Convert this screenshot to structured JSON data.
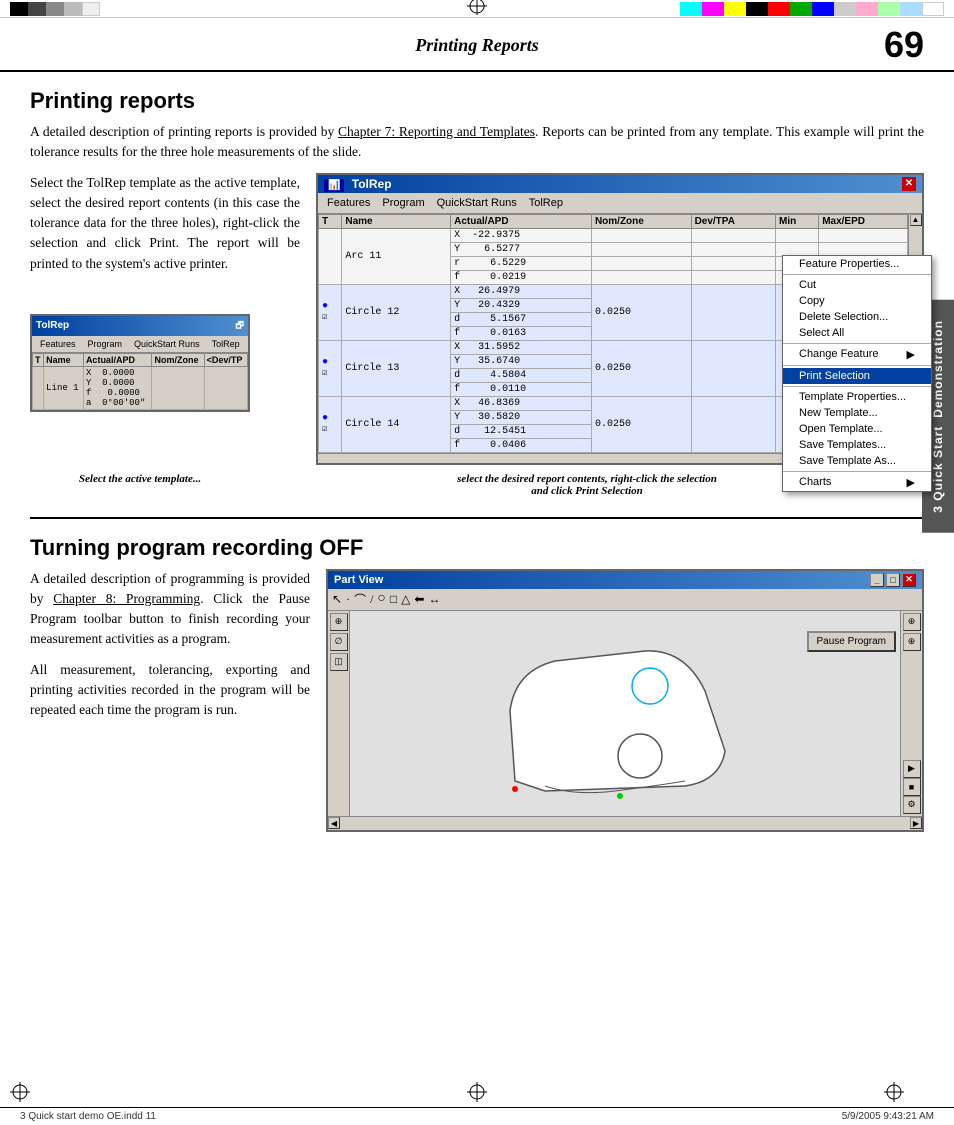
{
  "page": {
    "title": "Printing Reports",
    "page_number": "69"
  },
  "top_bar": {
    "color_squares": [
      "#000",
      "#444",
      "#888",
      "#bbb",
      "#eee"
    ],
    "color_bars_right": [
      "#00FFFF",
      "#FF00FF",
      "#FFFF00",
      "#000",
      "#ff0000",
      "#00aa00",
      "#0000ff",
      "#cccccc",
      "#ffaabb",
      "#aaffaa",
      "#aaddff",
      "#ffffff"
    ]
  },
  "section1": {
    "title": "Printing reports",
    "body1": "A detailed description of printing reports is provided by Chapter 7:  Reporting and Templates.  Reports can be printed from any template.  This example will print the tolerance results for the three hole measurements of the slide.",
    "body2": "Select the TolRep template as the active template, select the desired report contents (in this case the tolerance data for the three holes), right-click the selection and click Print.  The report will be printed to the system's active printer.",
    "link1": "Chapter 7:  Reporting and Templates"
  },
  "tolrep_window": {
    "title": "TolRep",
    "menu_items": [
      "Features",
      "Program",
      "QuickStart Runs",
      "TolRep"
    ],
    "table_headers": [
      "T",
      "Name",
      "Actual/APD",
      "Nom/Zone",
      "Dev/TPA",
      "Min",
      "Max/EPD"
    ],
    "rows": [
      {
        "name": "Arc 11",
        "axis": [
          "X",
          "Y",
          "r",
          "f"
        ],
        "values": [
          "-22.9375",
          "6.5277",
          "6.5229",
          "0.0219"
        ],
        "nom_zone": "",
        "dev_tpa": "",
        "min": "",
        "max_epd": "",
        "dot": false
      },
      {
        "name": "Circle 12",
        "axis": [
          "X",
          "Y",
          "d",
          "f"
        ],
        "values": [
          "26.4979",
          "20.4329",
          "5.1567",
          "0.0163"
        ],
        "nom_zone": "0.0250",
        "dev_tpa": "",
        "min": "",
        "max_epd": "",
        "dot": true
      },
      {
        "name": "Circle 13",
        "axis": [
          "X",
          "Y",
          "d",
          "f"
        ],
        "values": [
          "31.5952",
          "35.6740",
          "4.5804",
          "0.0110"
        ],
        "nom_zone": "0.0250",
        "dev_tpa": "",
        "min": "",
        "max_epd": "",
        "dot": true
      },
      {
        "name": "Circle 14",
        "axis": [
          "X",
          "Y",
          "d",
          "f"
        ],
        "values": [
          "46.8369",
          "30.5820",
          "12.5451",
          "0.0406"
        ],
        "nom_zone": "0.0250",
        "dev_tpa": "",
        "min": "",
        "max_epd": "",
        "dot": true
      }
    ]
  },
  "context_menu": {
    "items": [
      {
        "label": "Feature Properties...",
        "separator": false,
        "arrow": false
      },
      {
        "label": "",
        "separator": true
      },
      {
        "label": "Cut",
        "separator": false,
        "arrow": false
      },
      {
        "label": "Copy",
        "separator": false,
        "arrow": false
      },
      {
        "label": "Delete Selection...",
        "separator": false,
        "arrow": false
      },
      {
        "label": "Select All",
        "separator": false,
        "arrow": false
      },
      {
        "label": "",
        "separator": true
      },
      {
        "label": "Change Feature",
        "separator": false,
        "arrow": true
      },
      {
        "label": "",
        "separator": true
      },
      {
        "label": "Print Selection",
        "separator": false,
        "arrow": false,
        "highlighted": true
      },
      {
        "label": "",
        "separator": true
      },
      {
        "label": "Template Properties...",
        "separator": false,
        "arrow": false
      },
      {
        "label": "New Template...",
        "separator": false,
        "arrow": false
      },
      {
        "label": "Open Template...",
        "separator": false,
        "arrow": false
      },
      {
        "label": "Save Templates...",
        "separator": false,
        "arrow": false
      },
      {
        "label": "Save Template As...",
        "separator": false,
        "arrow": false
      },
      {
        "label": "",
        "separator": true
      },
      {
        "label": "Charts",
        "separator": false,
        "arrow": true
      }
    ]
  },
  "small_tolrep": {
    "title": "TolRep",
    "menu_items": [
      "Features",
      "Program",
      "QuickStart Runs",
      "TolRep"
    ],
    "headers": [
      "T",
      "Name",
      "Actual/APD",
      "Nom/Zone",
      "<Dev/TP"
    ],
    "rows": [
      {
        "name": "Line 1",
        "axis": [
          "X",
          "Y",
          "f",
          "a"
        ],
        "values": [
          "0.0000",
          "0.0000",
          "0.0000",
          "0°00'00\""
        ]
      }
    ]
  },
  "captions": {
    "left": "Select the active template...",
    "right": "select the desired report contents, right-click the selection\nand click Print Selection"
  },
  "section2": {
    "title": "Turning program recording OFF",
    "body1": "A  detailed  description  of  programming is provided by Chapter 8:  Programming. Click the Pause Program toolbar button to finish recording your measurement activities as a program.",
    "body2": "All  measurement,  tolerancing,  exporting and printing activities recorded in the program will be repeated each time the program is run.",
    "link1": "Chapter 8:  Programming"
  },
  "part_view": {
    "title": "Part View",
    "toolbar_icons": [
      "arrow",
      "dot",
      "arc",
      "line",
      "circle",
      "rect",
      "triangle",
      "arrow-right",
      "←→"
    ],
    "pause_button": "Pause Program"
  },
  "side_tab": {
    "line1": "3  Quick Start",
    "line2": "Demonstration"
  },
  "bottom_bar": {
    "left": "3 Quick start demo OE.indd   11",
    "center": "⊕",
    "right": "5/9/2005   9:43:21 AM"
  }
}
